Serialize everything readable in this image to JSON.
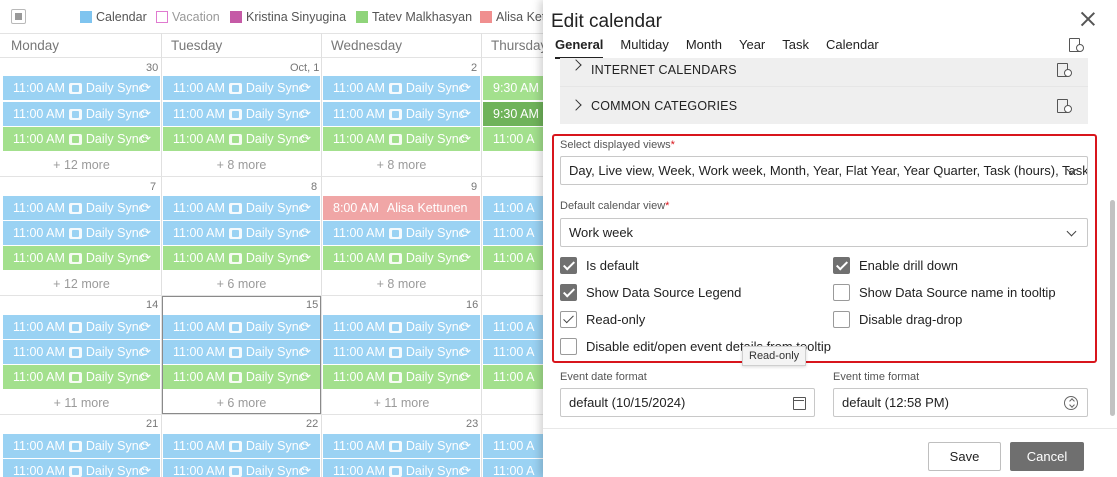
{
  "legend": {
    "items": [
      {
        "label": "Calendar",
        "color": "#7fc4ef"
      },
      {
        "label": "Vacation",
        "color": "#e07ad0"
      },
      {
        "label": "Kristina Sinyugina",
        "color": "#c55aa6"
      },
      {
        "label": "Tatev Malkhasyan",
        "color": "#8fd47a"
      },
      {
        "label": "Alisa Ket",
        "color": "#f08f8f"
      }
    ]
  },
  "calendar": {
    "days": [
      "Monday",
      "Tuesday",
      "Wednesday",
      "Thursday"
    ],
    "week1": {
      "nums": [
        "30",
        "Oct, 1",
        "2"
      ],
      "more": [
        "+ 12 more",
        "+ 8 more",
        "+ 8 more"
      ]
    },
    "week2": {
      "nums": [
        "7",
        "8",
        "9"
      ],
      "more": [
        "+ 12 more",
        "+ 6 more",
        "+ 8 more"
      ]
    },
    "week3": {
      "nums": [
        "14",
        "15",
        "16"
      ],
      "more": [
        "+ 11 more",
        "+ 6 more",
        "+ 11 more"
      ]
    },
    "week4": {
      "nums": [
        "21",
        "22",
        "23"
      ]
    },
    "event_time": "11:00 AM",
    "event_title": "Daily Sync",
    "thu_time1": "9:30 AM",
    "thu_time2": "11:00 A",
    "red_event_time": "8:00 AM",
    "red_event_title": "Alisa Kettunen"
  },
  "dialog": {
    "title": "Edit calendar",
    "tabs": [
      "General",
      "Multiday",
      "Month",
      "Year",
      "Task",
      "Calendar"
    ],
    "sections": {
      "internet": "INTERNET CALENDARS",
      "common": "COMMON CATEGORIES"
    },
    "displayed_views": {
      "label": "Select displayed views",
      "required": "*",
      "value": "Day, Live view, Week, Work week, Month, Year, Flat Year, Year Quarter, Task (hours), Task..."
    },
    "default_view": {
      "label": "Default calendar view",
      "required": "*",
      "value": "Work week"
    },
    "checkboxes": {
      "is_default": {
        "label": "Is default",
        "checked": true
      },
      "enable_drill": {
        "label": "Enable drill down",
        "checked": true
      },
      "show_legend": {
        "label": "Show Data Source Legend",
        "checked": true
      },
      "show_name_tooltip": {
        "label": "Show Data Source name in tooltip",
        "checked": false
      },
      "read_only": {
        "label": "Read-only",
        "checked": true
      },
      "disable_drag": {
        "label": "Disable drag-drop",
        "checked": false
      },
      "disable_edit": {
        "label": "Disable edit/open event details from tooltip",
        "checked": false
      }
    },
    "tooltip": "Read-only",
    "date_format": {
      "label": "Event date format",
      "value": "default (10/15/2024)"
    },
    "time_format": {
      "label": "Event time format",
      "value": "default (12:58 PM)"
    },
    "save_label": "Save",
    "cancel_label": "Cancel"
  }
}
